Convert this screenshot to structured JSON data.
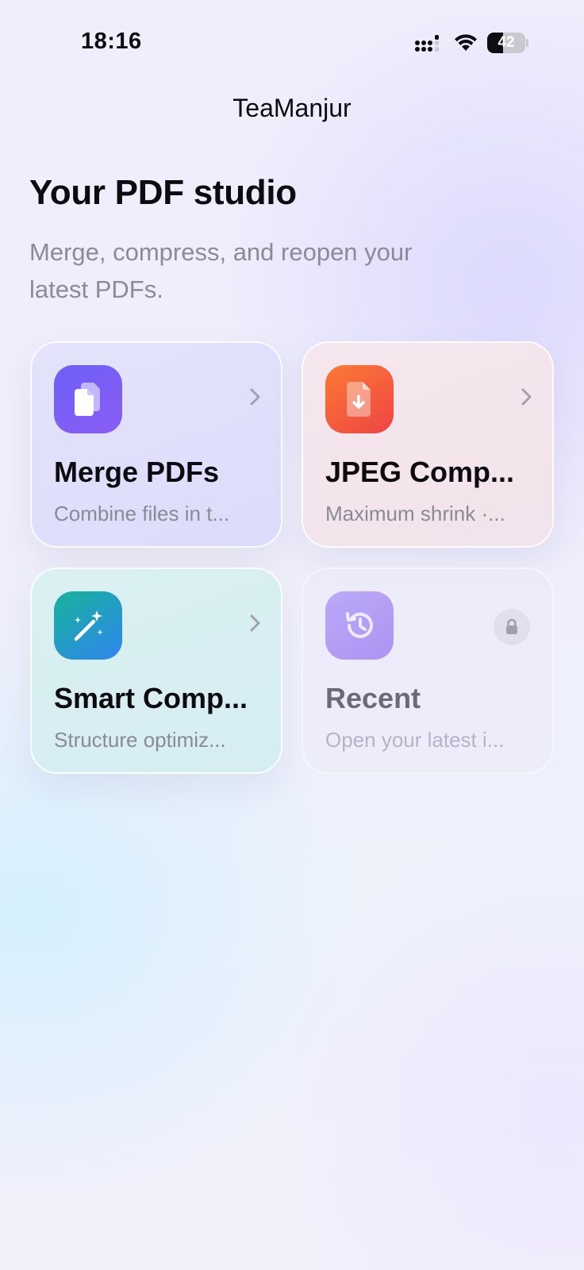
{
  "status_bar": {
    "time": "18:16",
    "battery_level": "42"
  },
  "nav": {
    "title": "TeaManjur"
  },
  "header": {
    "title": "Your PDF studio",
    "subtitle": "Merge, compress, and reopen your latest PDFs."
  },
  "cards": [
    {
      "title": "Merge PDFs",
      "subtitle": "Combine files in t...",
      "icon": "merge-documents-icon",
      "accent": "#7c5cf6",
      "action": "chevron-right-icon"
    },
    {
      "title": "JPEG Comp...",
      "subtitle": "Maximum shrink ·...",
      "icon": "file-download-icon",
      "accent": "#f5563d",
      "action": "chevron-right-icon"
    },
    {
      "title": "Smart Comp...",
      "subtitle": "Structure optimiz...",
      "icon": "magic-wand-icon",
      "accent": "#1fa6c2",
      "action": "chevron-right-icon"
    },
    {
      "title": "Recent",
      "subtitle": "Open your latest i...",
      "icon": "history-icon",
      "accent": "#b09af5",
      "action": "lock-icon",
      "locked": true
    }
  ]
}
